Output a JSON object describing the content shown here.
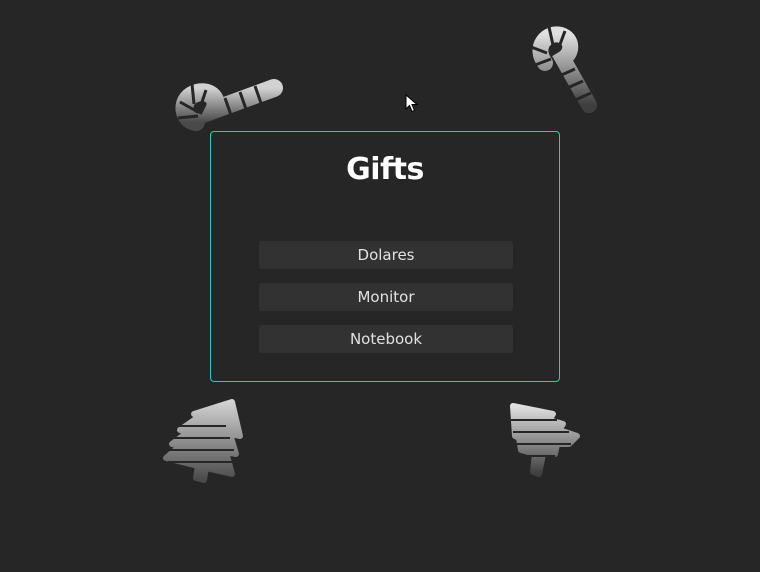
{
  "panel": {
    "title": "Gifts",
    "items": [
      {
        "label": "Dolares"
      },
      {
        "label": "Monitor"
      },
      {
        "label": "Notebook"
      }
    ]
  },
  "colors": {
    "background": "#262626",
    "panel_border": "#2fc6c9",
    "button_bg": "#323232",
    "text": "#ffffff"
  },
  "decorations": [
    "candy-cane-icon",
    "candy-cane-icon",
    "christmas-tree-icon",
    "christmas-tree-icon"
  ]
}
